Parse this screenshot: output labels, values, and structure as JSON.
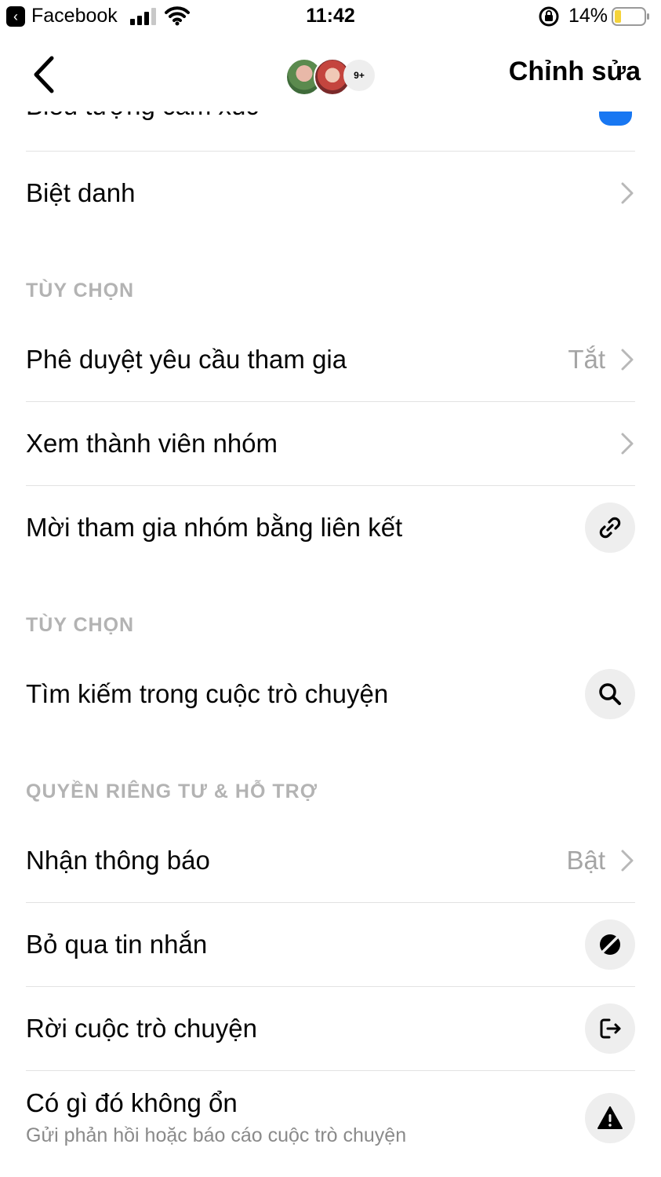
{
  "status_bar": {
    "back_glyph": "‹",
    "app": "Facebook",
    "time": "11:42",
    "battery": "14%"
  },
  "header": {
    "more_members": "9+",
    "edit_label": "Chỉnh sửa"
  },
  "rows": {
    "emoji": "Biểu tượng cảm xúc",
    "nickname": "Biệt danh",
    "section_options_1": "TÙY CHỌN",
    "approve": "Phê duyệt yêu cầu tham gia",
    "approve_value": "Tắt",
    "members": "Xem thành viên nhóm",
    "invite_link": "Mời tham gia nhóm bằng liên kết",
    "section_options_2": "TÙY CHỌN",
    "search": "Tìm kiếm trong cuộc trò chuyện",
    "section_privacy": "QUYỀN RIÊNG TƯ & HỖ TRỢ",
    "notifications": "Nhận thông báo",
    "notifications_value": "Bật",
    "ignore": "Bỏ qua tin nhắn",
    "leave": "Rời cuộc trò chuyện",
    "problem": "Có gì đó không ổn",
    "problem_sub": "Gửi phản hồi hoặc báo cáo cuộc trò chuyện"
  },
  "icons": {
    "chevron": "chevron-right-icon",
    "link": "link-icon",
    "search": "search-icon",
    "ignore": "eye-slash-icon",
    "leave": "exit-icon",
    "warning": "warning-icon"
  },
  "colors": {
    "accent": "#1877f2",
    "secondary_text": "#a5a5a5",
    "section_header": "#b3b3b3",
    "battery_low": "#f5d33a"
  }
}
